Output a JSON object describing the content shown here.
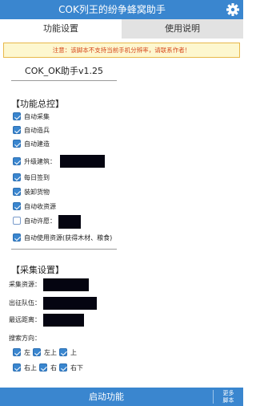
{
  "app": {
    "title": "COK列王的纷争蜂窝助手",
    "settings_icon": "gear-icon"
  },
  "tabs": [
    {
      "label": "功能设置",
      "active": true
    },
    {
      "label": "使用说明",
      "active": false
    }
  ],
  "notice": "注意：该脚本不支持当前手机分辨率，请联系作者！",
  "version": "COK_OK助手v1.25",
  "function_control": {
    "title": "【功能总控】",
    "items": [
      {
        "label": "自动采集",
        "checked": true
      },
      {
        "label": "自动造兵",
        "checked": true
      },
      {
        "label": "自动建造",
        "checked": true
      },
      {
        "label": "升级建筑：",
        "checked": true
      },
      {
        "label": "每日签到",
        "checked": true
      },
      {
        "label": "装卸货物",
        "checked": true
      },
      {
        "label": "自动收资源",
        "checked": true
      },
      {
        "label": "自动许愿：",
        "checked": false
      },
      {
        "label": "自动使用资源(获得木材、粮食)",
        "checked": true
      }
    ]
  },
  "collect_settings": {
    "title": "【采集设置】",
    "fields": [
      {
        "label": "采集资源："
      },
      {
        "label": "出征队伍："
      },
      {
        "label": "最远距离："
      }
    ],
    "direction_label": "搜索方向：",
    "directions_row1": [
      {
        "label": "左",
        "checked": true
      },
      {
        "label": "左上",
        "checked": true
      },
      {
        "label": "上",
        "checked": true
      }
    ],
    "directions_row2": [
      {
        "label": "右上",
        "checked": true
      },
      {
        "label": "右",
        "checked": true
      },
      {
        "label": "右下",
        "checked": true
      }
    ]
  },
  "bottom": {
    "start_label": "启动功能",
    "more_label_line1": "更多",
    "more_label_line2": "脚本"
  },
  "colors": {
    "primary": "#3a86cf",
    "notice_text": "#d64a1e",
    "notice_bg": "#fdf7cf"
  }
}
